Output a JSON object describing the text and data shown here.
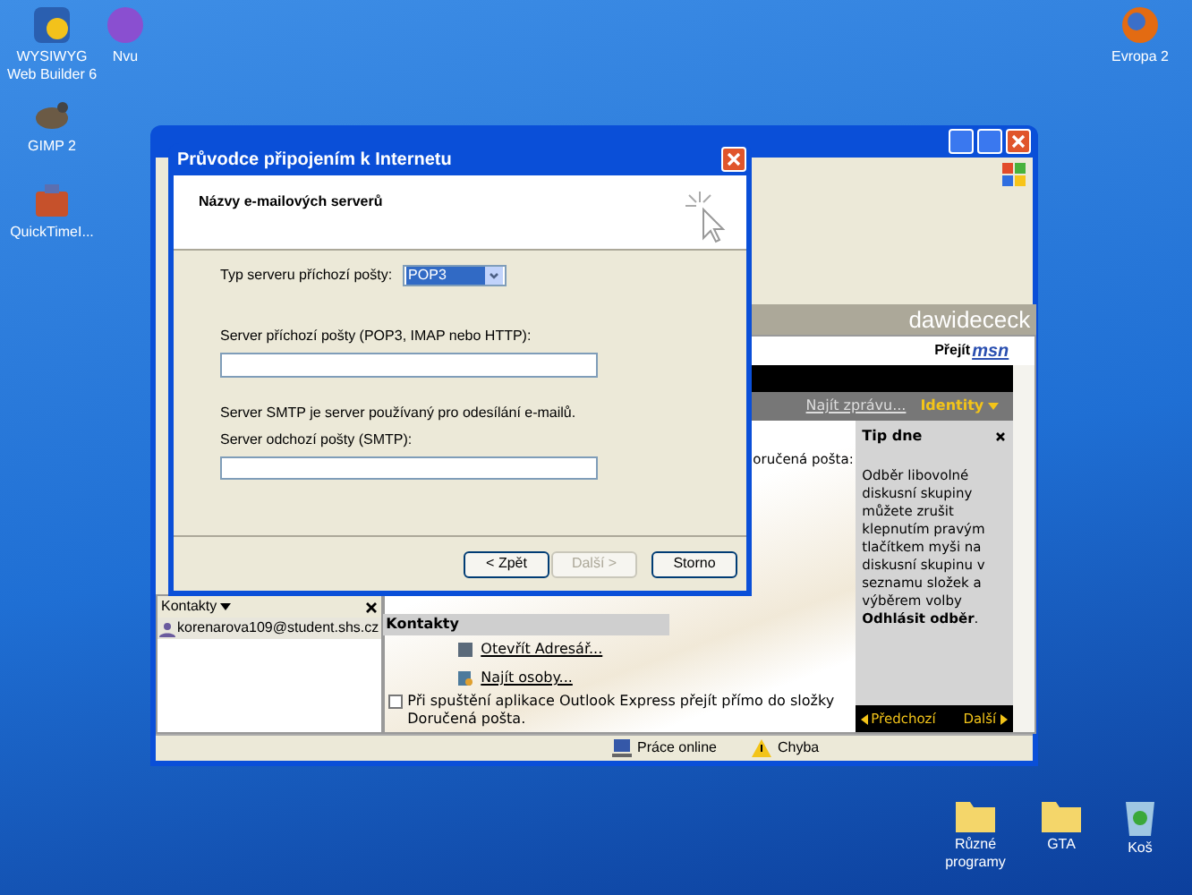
{
  "desktop_icons": [
    {
      "label": "WYSIWYG Web Builder 6",
      "kind": "webbuilder"
    },
    {
      "label": "Nvu",
      "kind": "nvu"
    },
    {
      "label": "GIMP 2",
      "kind": "gimp"
    },
    {
      "label": "QuickTimeI...",
      "kind": "quicktime"
    },
    {
      "label": "Evropa 2",
      "kind": "browser"
    },
    {
      "label": "Různé programy",
      "kind": "folder"
    },
    {
      "label": "GTA",
      "kind": "folder"
    },
    {
      "label": "Koš",
      "kind": "bin"
    }
  ],
  "outlook": {
    "header_name": "dawidececk",
    "msn_link": "Přejít",
    "msn_logo": "msn",
    "find_message": "Najít zprávu...",
    "identity_menu": "Identity",
    "inbox_fragment": "oručená pošta:",
    "tip": {
      "title": "Tip dne",
      "text": "Odběr libovolné diskusní skupiny můžete zrušit klepnutím pravým tlačítkem myši na diskusní skupinu v seznamu složek a výběrem volby **Odhlásit odběr**.",
      "previous": "Předchozí",
      "next": "Další"
    },
    "contacts_pane": {
      "title": "Kontakty",
      "items": [
        {
          "label": "korenarova109@student.shs.cz",
          "selected": true
        }
      ]
    },
    "contacts_section": {
      "title": "Kontakty",
      "links": [
        {
          "label": "Otevřít Adresář...",
          "kind": "book"
        },
        {
          "label": "Najít osoby...",
          "kind": "find"
        }
      ]
    },
    "startup_option": {
      "label": "Při spuštění aplikace Outlook Express přejít přímo do složky Doručená pošta.",
      "checked": false
    },
    "status_bar": [
      {
        "label": "Práce online",
        "kind": "online"
      },
      {
        "label": "Chyba",
        "kind": "warning"
      }
    ]
  },
  "dialog": {
    "title": "Průvodce připojením k Internetu",
    "heading": "Názvy e-mailových serverů",
    "server_type": {
      "label": "Typ serveru příchozí pošty:",
      "value": "POP3"
    },
    "incoming": {
      "label": "Server příchozí pošty (POP3, IMAP nebo HTTP):"
    },
    "smtp_note": "Server SMTP je server používaný pro odesílání e-mailů.",
    "outgoing": {
      "label": "Server odchozí pošty (SMTP):"
    },
    "buttons": [
      {
        "label": "< Zpět",
        "disabled": false
      },
      {
        "label": "Další >",
        "disabled": true
      },
      {
        "label": "Storno",
        "disabled": false
      }
    ]
  }
}
